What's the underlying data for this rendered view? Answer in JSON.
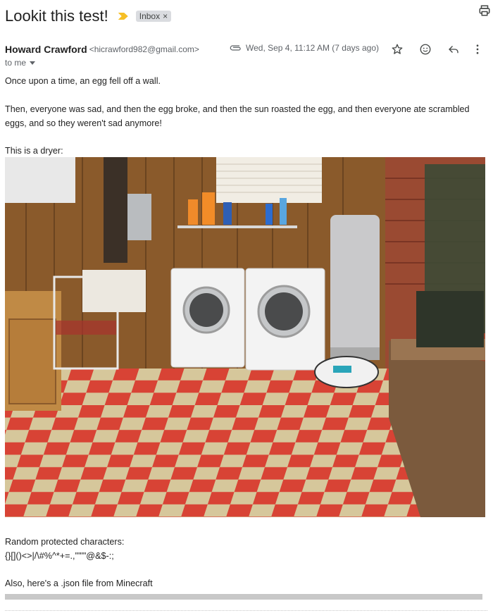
{
  "email": {
    "subject": "Lookit this test!",
    "label": "Inbox",
    "label_close": "×",
    "sender_name": "Howard Crawford",
    "sender_email": "<hicrawford982@gmail.com>",
    "date": "Wed, Sep 4, 11:12 AM (7 days ago)",
    "to": "to me",
    "body": {
      "p1": "Once upon a time, an egg fell off a wall.",
      "p2": "Then, everyone was sad, and then the egg broke, and then the sun roasted the egg, and then everyone ate scrambled eggs, and so they weren't sad anymore!",
      "p3": "This is a dryer:",
      "p4": "Random protected characters:",
      "p5": "{}[]()<>|/\\#%^*+=.,'\"\"\"@&$-:;",
      "p6": "Also, here's a .json file from Minecraft"
    }
  },
  "icons": {
    "importance": "importance-marker-icon",
    "print": "print-icon",
    "attachment": "attachment-icon",
    "star": "star-icon",
    "emoji": "emoji-icon",
    "reply": "reply-icon",
    "more": "more-vert-icon",
    "caret": "caret-down-icon"
  },
  "colors": {
    "importance": "#f6bf26",
    "label_bg": "#dadce0",
    "floor_red": "#d84335",
    "floor_tan": "#d6c79b"
  }
}
